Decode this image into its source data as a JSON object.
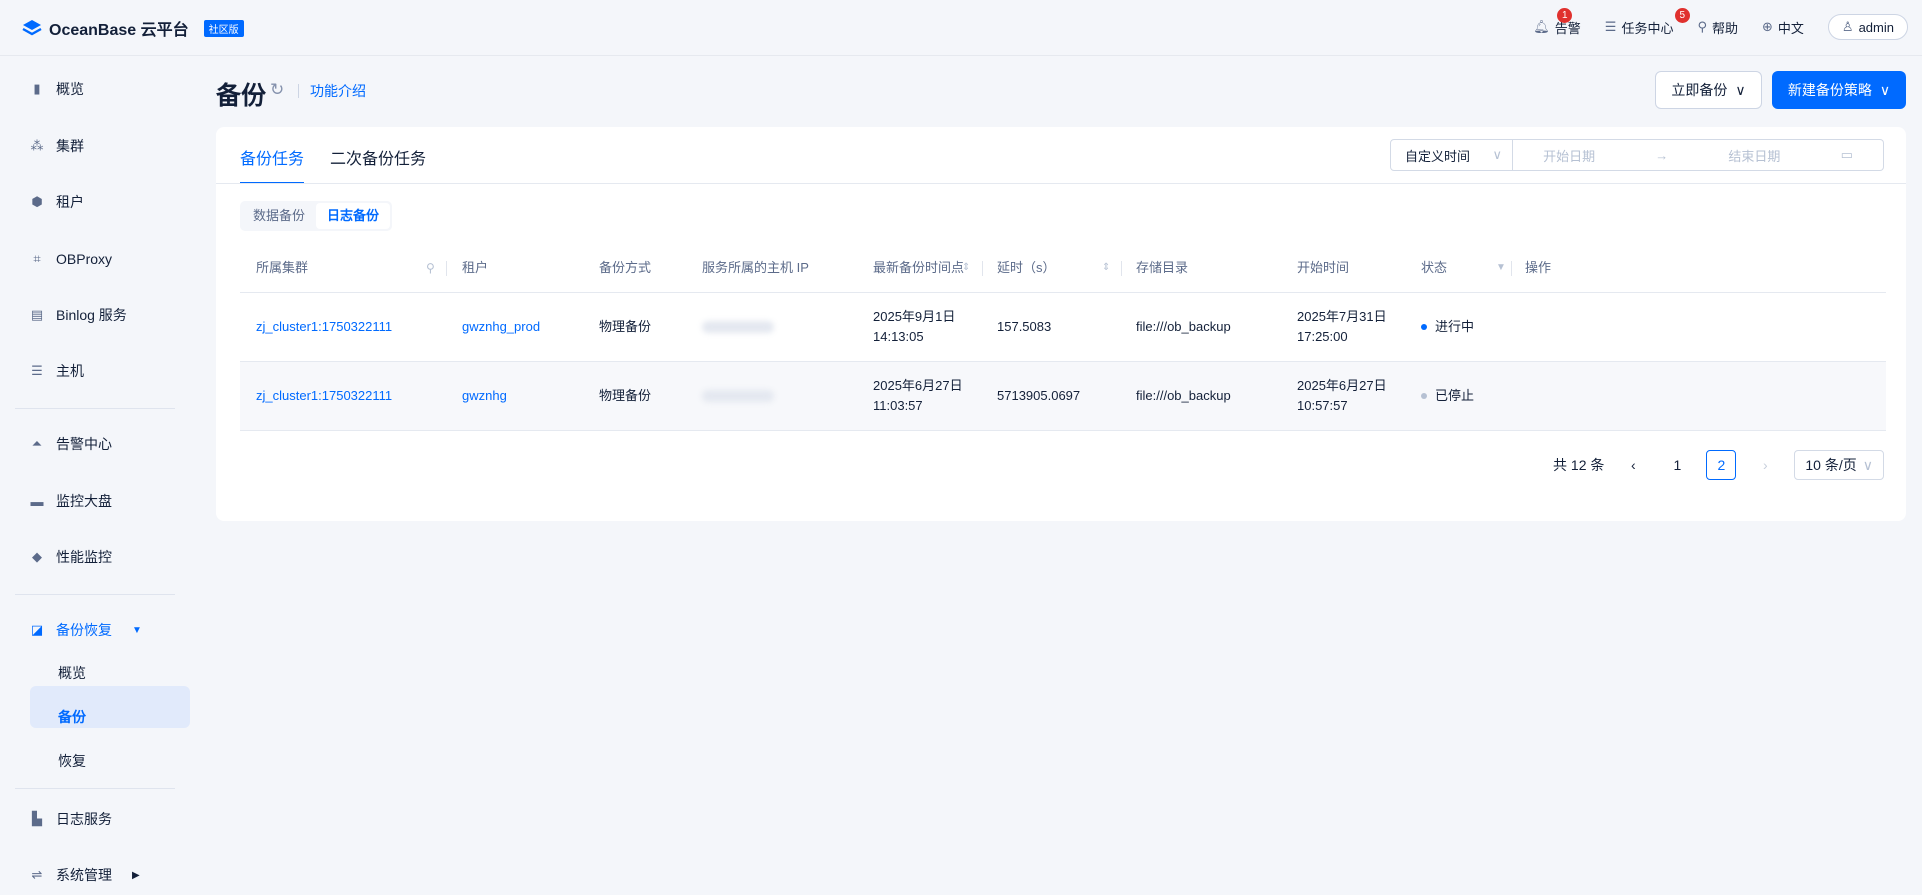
{
  "app": {
    "name": "OceanBase 云平台",
    "edition": "社区版"
  },
  "topnav": {
    "alerts": {
      "label": "告警",
      "badge": "1"
    },
    "tasks": {
      "label": "任务中心",
      "badge": "5"
    },
    "help": "帮助",
    "language": "中文",
    "user": "admin"
  },
  "sidebar": {
    "items": [
      {
        "label": "概览",
        "icon": "bar-chart-icon"
      },
      {
        "label": "集群",
        "icon": "cluster-icon"
      },
      {
        "label": "租户",
        "icon": "tenant-icon"
      },
      {
        "label": "OBProxy",
        "icon": "proxy-icon"
      },
      {
        "label": "Binlog 服务",
        "icon": "binlog-icon"
      },
      {
        "label": "主机",
        "icon": "host-icon"
      },
      {
        "label": "告警中心",
        "icon": "alarm-icon"
      },
      {
        "label": "监控大盘",
        "icon": "monitor-icon"
      },
      {
        "label": "性能监控",
        "icon": "performance-icon"
      },
      {
        "label": "备份恢复",
        "icon": "backup-icon"
      },
      {
        "label": "日志服务",
        "icon": "log-icon"
      },
      {
        "label": "系统管理",
        "icon": "settings-icon"
      }
    ],
    "backup_sub": [
      "概览",
      "备份",
      "恢复"
    ]
  },
  "page": {
    "title": "备份",
    "feature_link": "功能介绍",
    "btn_backup_now": "立即备份",
    "btn_new_policy": "新建备份策略"
  },
  "tabs": [
    "备份任务",
    "二次备份任务"
  ],
  "date_filter": {
    "mode": "自定义时间",
    "start_placeholder": "开始日期",
    "end_placeholder": "结束日期"
  },
  "segments": [
    "数据备份",
    "日志备份"
  ],
  "table": {
    "columns": [
      "所属集群",
      "租户",
      "备份方式",
      "服务所属的主机 IP",
      "最新备份时间点",
      "延时（s）",
      "存储目录",
      "开始时间",
      "状态",
      "操作"
    ],
    "rows": [
      {
        "cluster": "zj_cluster1:1750322111",
        "tenant": "gwznhg_prod",
        "method": "物理备份",
        "ip": "",
        "latest_date": "2025年9月1日",
        "latest_time": "14:13:05",
        "delay": "157.5083",
        "dir": "file:///ob_backup",
        "start_date": "2025年7月31日",
        "start_time": "17:25:00",
        "status": "进行中",
        "status_color": "#006aff"
      },
      {
        "cluster": "zj_cluster1:1750322111",
        "tenant": "gwznhg",
        "method": "物理备份",
        "ip": "",
        "latest_date": "2025年6月27日",
        "latest_time": "11:03:57",
        "delay": "5713905.0697",
        "dir": "file:///ob_backup",
        "start_date": "2025年6月27日",
        "start_time": "10:57:57",
        "status": "已停止",
        "status_color": "#b6c1d3"
      }
    ]
  },
  "pagination": {
    "total": "共 12 条",
    "pages": [
      "1",
      "2"
    ],
    "current": "2",
    "page_size": "10 条/页"
  },
  "colors": {
    "primary": "#006aff",
    "alert": "#e0312e"
  }
}
